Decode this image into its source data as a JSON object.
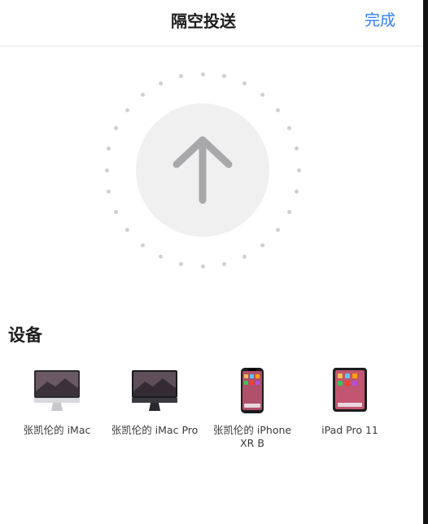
{
  "nav": {
    "title": "隔空投送",
    "done": "完成"
  },
  "section": {
    "devices_title": "设备"
  },
  "devices": [
    {
      "label": "张凯伦的 iMac",
      "icon": "imac-icon"
    },
    {
      "label": "张凯伦的 iMac Pro",
      "icon": "imac-pro-icon"
    },
    {
      "label": "张凯伦的 iPhone XR B",
      "icon": "iphone-icon"
    },
    {
      "label": "iPad Pro 11",
      "icon": "ipad-icon"
    }
  ],
  "colors": {
    "accent": "#2f7df6",
    "arrow": "#a8a8ab",
    "ring_dots": "#d0d0d0"
  }
}
